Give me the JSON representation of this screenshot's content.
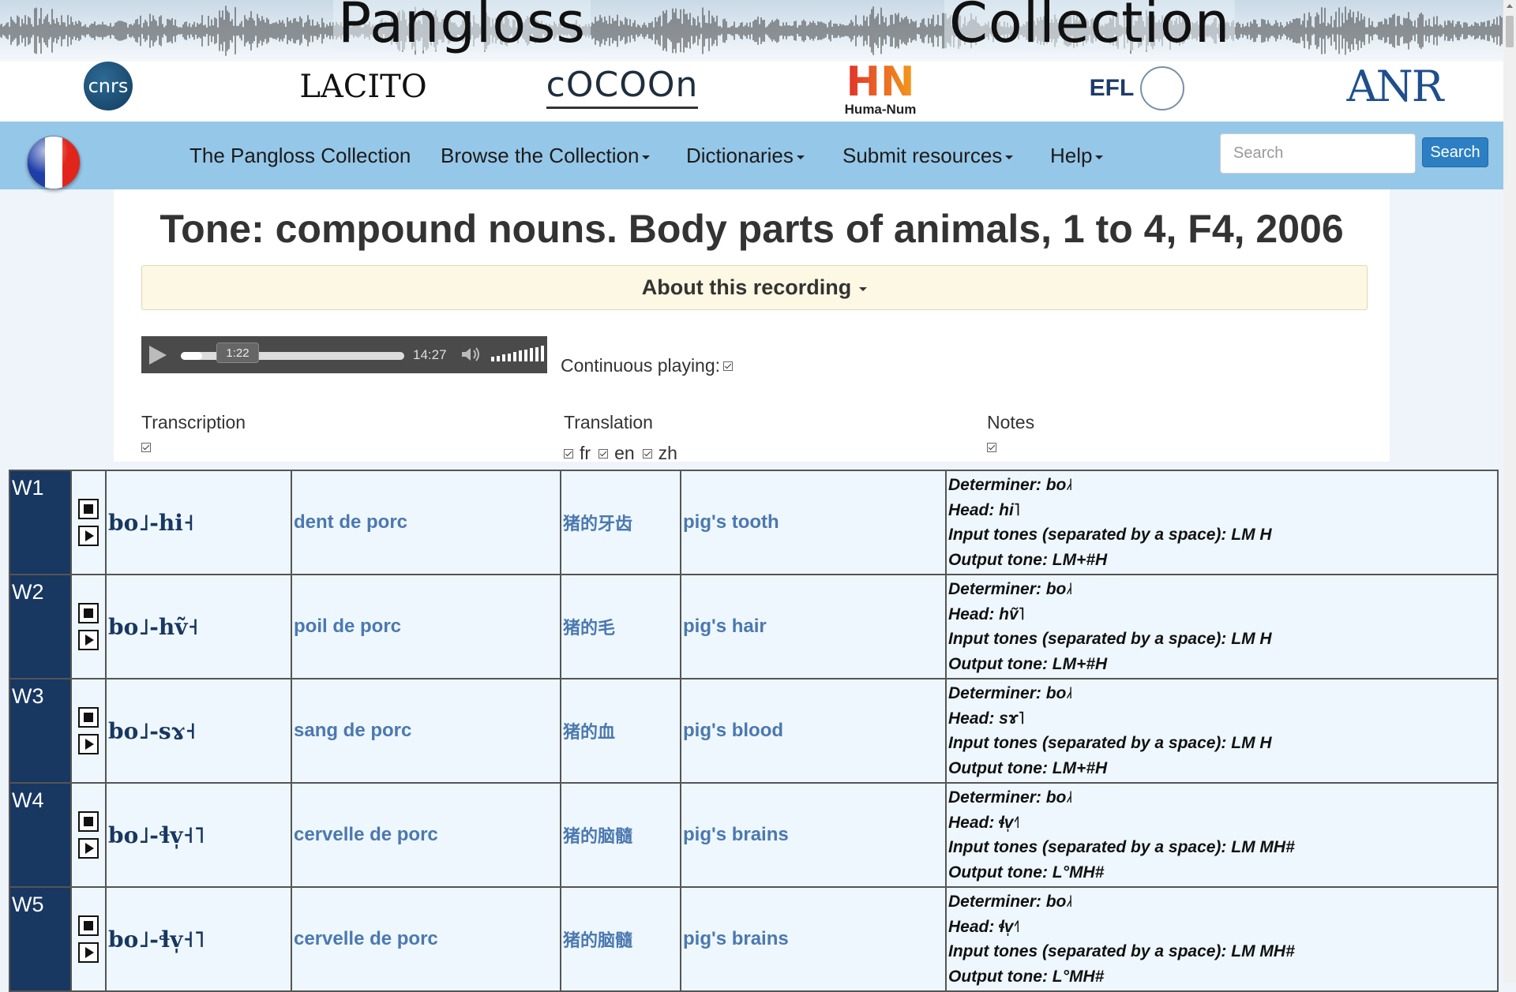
{
  "banner": {
    "title_left": "Pangloss",
    "title_right": "Collection",
    "logos": {
      "cnrs": "cnrs",
      "lacito": "LACITO",
      "cocoon": "cOCOOn",
      "humanum": "Huma-Num",
      "efl": "EFL",
      "anr": "ANR"
    }
  },
  "nav": {
    "items": [
      {
        "label": "The Pangloss Collection",
        "dropdown": false
      },
      {
        "label": "Browse the Collection",
        "dropdown": true
      },
      {
        "label": "Dictionaries",
        "dropdown": true
      },
      {
        "label": "Submit resources",
        "dropdown": true
      },
      {
        "label": "Help",
        "dropdown": true
      }
    ],
    "search_placeholder": "Search",
    "search_button": "Search"
  },
  "page": {
    "title": "Tone: compound nouns. Body parts of animals, 1 to 4, F4, 2006",
    "about_label": "About this recording"
  },
  "player": {
    "current_time": "1:22",
    "total_time": "14:27",
    "progress": 0.095,
    "volume_level": 1.0
  },
  "options": {
    "continuous_label": "Continuous playing:",
    "transcription_label": "Transcription",
    "translation_label": "Translation",
    "notes_label": "Notes",
    "languages": [
      "fr",
      "en",
      "zh"
    ]
  },
  "rows": [
    {
      "id": "W1",
      "form": "bo˩-hi˧",
      "fr": "dent de porc",
      "zh": "猪的牙齿",
      "en": "pig's tooth",
      "notes": [
        "Determiner: bo˩˧",
        "Head: hi˥",
        "Input tones (separated by a space): LM H",
        "Output tone: LM+#H"
      ]
    },
    {
      "id": "W2",
      "form": "bo˩-hṽ˧",
      "fr": "poil de porc",
      "zh": "猪的毛",
      "en": "pig's hair",
      "notes": [
        "Determiner: bo˩˧",
        "Head: hṽ˥",
        "Input tones (separated by a space): LM H",
        "Output tone: LM+#H"
      ]
    },
    {
      "id": "W3",
      "form": "bo˩-sɤ˧",
      "fr": "sang de porc",
      "zh": "猪的血",
      "en": "pig's blood",
      "notes": [
        "Determiner: bo˩˧",
        "Head: sɤ˥",
        "Input tones (separated by a space): LM H",
        "Output tone: LM+#H"
      ]
    },
    {
      "id": "W4",
      "form": "bo˩-ɬv̩˧˥",
      "fr": "cervelle de porc",
      "zh": "猪的脑髓",
      "en": "pig's brains",
      "notes": [
        "Determiner: bo˩˧",
        "Head: ɬv̩˧˥",
        "Input tones (separated by a space): LM MH#",
        "Output tone: L°MH#"
      ]
    },
    {
      "id": "W5",
      "form": "bo˩-ɬv̩˧˥",
      "fr": "cervelle de porc",
      "zh": "猪的脑髓",
      "en": "pig's brains",
      "notes": [
        "Determiner: bo˩˧",
        "Head: ɬv̩˧˥",
        "Input tones (separated by a space): LM MH#",
        "Output tone: L°MH#"
      ]
    }
  ]
}
